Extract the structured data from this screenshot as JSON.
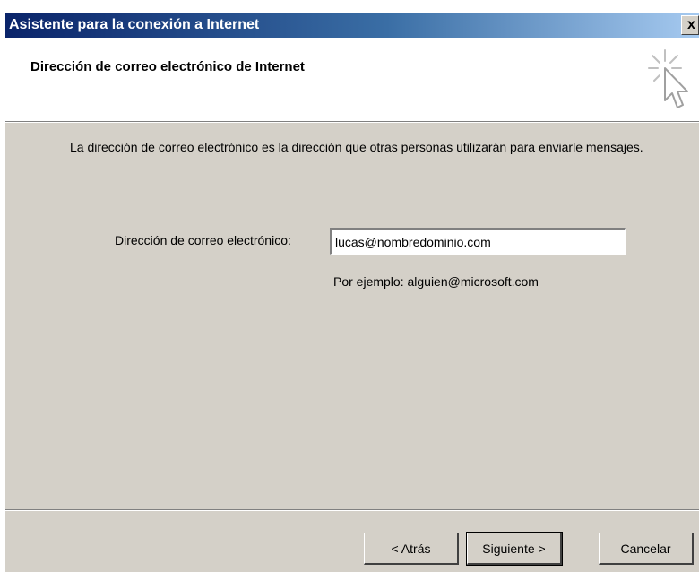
{
  "window": {
    "title": "Asistente para la conexión a Internet",
    "close_glyph": "x"
  },
  "header": {
    "title": "Dirección de correo electrónico de Internet",
    "icon": "wizard-cursor-icon"
  },
  "body": {
    "description": "La dirección de correo electrónico es la dirección que otras personas utilizarán para enviarle mensajes.",
    "email_label": "Dirección de correo electrónico:",
    "email_value": "lucas@nombredominio.com",
    "example": "Por ejemplo: alguien@microsoft.com"
  },
  "buttons": {
    "back": "< Atrás",
    "next": "Siguiente >",
    "cancel": "Cancelar"
  },
  "colors": {
    "titlebar_start": "#0a246a",
    "titlebar_end": "#a6caf0",
    "dialog_bg": "#d4d0c8"
  }
}
